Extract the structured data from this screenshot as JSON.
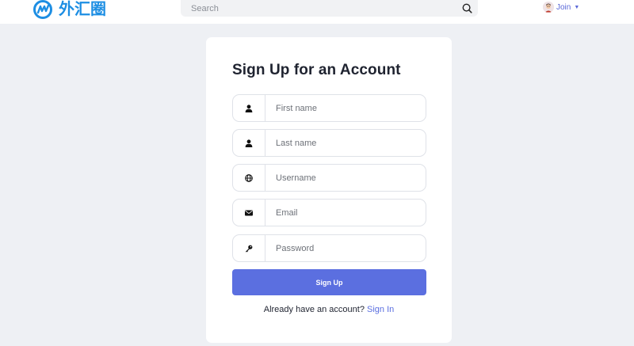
{
  "header": {
    "logo_text": "外汇圈",
    "search": {
      "placeholder": "Search",
      "value": ""
    },
    "user_menu": {
      "label": "Join"
    }
  },
  "form": {
    "title": "Sign Up for an Account",
    "fields": [
      {
        "placeholder": "First name",
        "value": "",
        "icon": "user-icon"
      },
      {
        "placeholder": "Last name",
        "value": "",
        "icon": "user-icon"
      },
      {
        "placeholder": "Username",
        "value": "",
        "icon": "globe-icon"
      },
      {
        "placeholder": "Email",
        "value": "",
        "icon": "envelope-icon"
      },
      {
        "placeholder": "Password",
        "value": "",
        "icon": "key-icon"
      }
    ],
    "submit_label": "Sign Up",
    "signin_prompt": "Already have an account?",
    "signin_link": "Sign In"
  },
  "colors": {
    "page_background": "#eef0f4",
    "accent": "#5b6fe0",
    "logo_blue": "#1d8ee3"
  }
}
